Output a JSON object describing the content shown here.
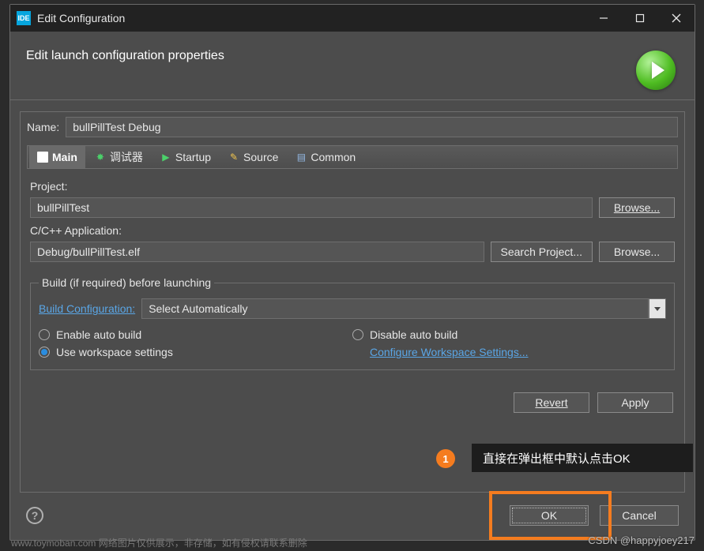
{
  "titlebar": {
    "title": "Edit Configuration"
  },
  "header": {
    "heading": "Edit launch configuration properties"
  },
  "name": {
    "label": "Name:",
    "value": "bullPillTest Debug"
  },
  "tabs": {
    "main": "Main",
    "debug": "调试器",
    "startup": "Startup",
    "source": "Source",
    "common": "Common"
  },
  "project": {
    "label": "Project:",
    "value": "bullPillTest",
    "browse": "Browse..."
  },
  "app": {
    "label": "C/C++ Application:",
    "value": "Debug/bullPillTest.elf",
    "search": "Search Project...",
    "browse": "Browse..."
  },
  "build": {
    "legend": "Build (if required) before launching",
    "config_label": "Build Configuration:",
    "config_value": "Select Automatically",
    "enable_auto": "Enable auto build",
    "disable_auto": "Disable auto build",
    "use_ws": "Use workspace settings",
    "cfg_ws": "Configure Workspace Settings..."
  },
  "midFooter": {
    "revert": "Revert",
    "apply": "Apply"
  },
  "bottom": {
    "ok": "OK",
    "cancel": "Cancel"
  },
  "annotation": {
    "num": "1",
    "text": "直接在弹出框中默认点击OK"
  },
  "watermark": {
    "csdn": "CSDN @happyjoey217",
    "bottom": "www.toymoban.com  网络图片仅供展示，非存储，如有侵权请联系删除"
  }
}
